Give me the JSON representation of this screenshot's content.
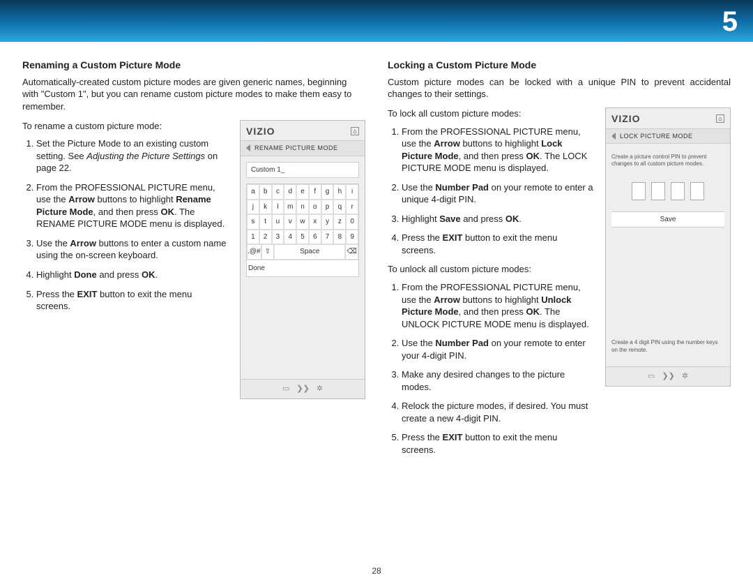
{
  "chapter_number": "5",
  "page_number": "28",
  "left": {
    "title": "Renaming a Custom Picture Mode",
    "intro": "Automatically-created custom picture modes are given generic names, beginning with \"Custom 1\", but you can rename custom picture modes to make them easy to remember.",
    "lead": "To rename a custom picture mode:",
    "steps": {
      "s1a": "Set the Picture Mode to an existing custom setting. See ",
      "s1b": "Adjusting the Picture Settings",
      "s1c": " on page 22.",
      "s2a": "From the PROFESSIONAL PICTURE menu, use the ",
      "s2b": "Arrow",
      "s2c": " buttons to highlight ",
      "s2d": "Rename Picture Mode",
      "s2e": ", and then press ",
      "s2f": "OK",
      "s2g": ". The RENAME PICTURE MODE menu is displayed.",
      "s3a": "Use the ",
      "s3b": "Arrow",
      "s3c": " buttons to enter a custom name using the on-screen keyboard.",
      "s4a": "Highlight ",
      "s4b": "Done",
      "s4c": " and press ",
      "s4d": "OK",
      "s4e": ".",
      "s5a": "Press the ",
      "s5b": "EXIT",
      "s5c": " button to exit the menu screens."
    },
    "device": {
      "logo": "VIZIO",
      "crumb": "RENAME PICTURE MODE",
      "field_value": "Custom 1_",
      "kb_rows": [
        [
          "a",
          "b",
          "c",
          "d",
          "e",
          "f",
          "g",
          "h",
          "i"
        ],
        [
          "j",
          "k",
          "l",
          "m",
          "n",
          "o",
          "p",
          "q",
          "r"
        ],
        [
          "s",
          "t",
          "u",
          "v",
          "w",
          "x",
          "y",
          "z",
          "0"
        ],
        [
          "1",
          "2",
          "3",
          "4",
          "5",
          "6",
          "7",
          "8",
          "9"
        ]
      ],
      "sym": ".@#",
      "shift": "⇧",
      "space": "Space",
      "backspace": "⌫",
      "done": "Done"
    }
  },
  "right": {
    "title": "Locking a Custom Picture Mode",
    "intro": "Custom picture modes can be locked with a unique PIN to prevent accidental changes to their settings.",
    "lead1": "To lock all custom picture modes:",
    "lock": {
      "s1a": "From the PROFESSIONAL PICTURE menu, use the ",
      "s1b": "Arrow",
      "s1c": " buttons to highlight ",
      "s1d": "Lock Picture Mode",
      "s1e": ", and then press ",
      "s1f": "OK",
      "s1g": ". The LOCK PICTURE MODE menu is displayed.",
      "s2a": "Use the ",
      "s2b": "Number Pad",
      "s2c": " on your remote to enter a unique 4-digit PIN.",
      "s3a": "Highlight ",
      "s3b": "Save",
      "s3c": " and press ",
      "s3d": "OK",
      "s3e": ".",
      "s4a": "Press the ",
      "s4b": "EXIT",
      "s4c": " button to exit the menu screens."
    },
    "lead2": "To unlock all custom picture modes:",
    "unlock": {
      "s1a": "From the PROFESSIONAL PICTURE menu, use the ",
      "s1b": "Arrow",
      "s1c": " buttons to highlight ",
      "s1d": "Unlock Picture Mode",
      "s1e": ", and then press ",
      "s1f": "OK",
      "s1g": ". The UNLOCK PICTURE MODE menu is displayed.",
      "s2a": "Use the ",
      "s2b": "Number Pad",
      "s2c": " on your remote to enter your 4-digit PIN.",
      "s3": "Make any desired changes to the picture modes.",
      "s4": "Relock the picture modes, if desired. You must create a new 4-digit PIN.",
      "s5a": "Press the ",
      "s5b": "EXIT",
      "s5c": " button to exit the menu screens."
    },
    "device": {
      "logo": "VIZIO",
      "crumb": "LOCK PICTURE MODE",
      "note1": "Create a picture control PIN to prevent changes to all custom picture modes.",
      "save": "Save",
      "note2": "Create a 4 digit PIN using the number keys on the remote."
    }
  },
  "footer_icons": {
    "a": "▭",
    "b": "❯❯",
    "c": "✲"
  }
}
